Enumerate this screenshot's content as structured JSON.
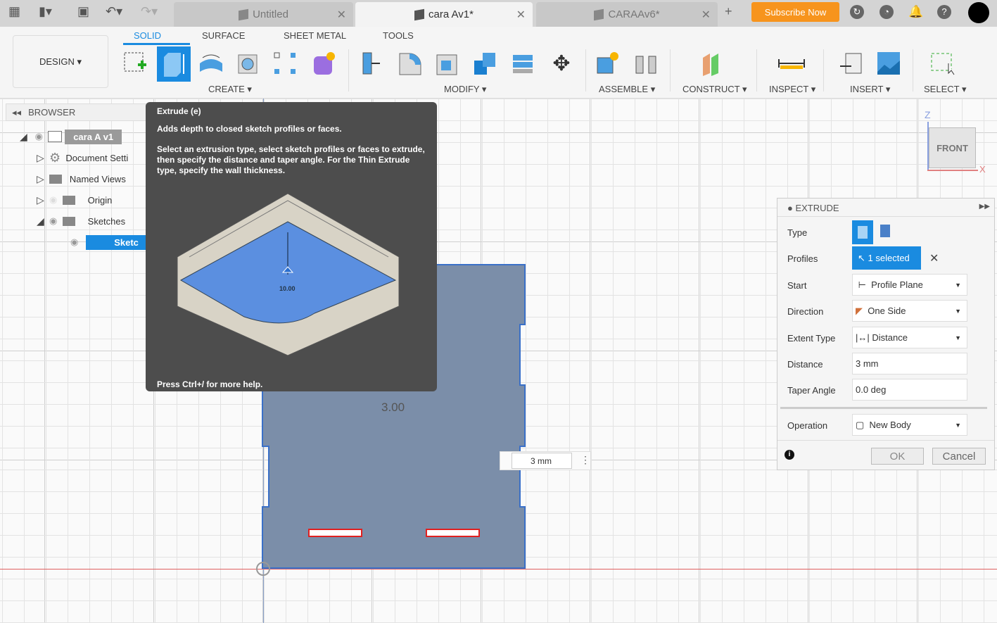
{
  "tabs": [
    {
      "label": "Untitled",
      "active": false
    },
    {
      "label": "cara Av1*",
      "active": true
    },
    {
      "label": "CARAAv6*",
      "active": false
    }
  ],
  "subscribe_label": "Subscribe Now",
  "toolbar": {
    "design_label": "DESIGN ▾",
    "tabs": [
      "SOLID",
      "SURFACE",
      "SHEET METAL",
      "TOOLS"
    ],
    "groups": [
      "CREATE ▾",
      "MODIFY ▾",
      "ASSEMBLE ▾",
      "CONSTRUCT ▾",
      "INSPECT ▾",
      "INSERT ▾",
      "SELECT ▾"
    ]
  },
  "browser": {
    "title": "BROWSER",
    "items": [
      "cara A v1",
      "Document Setti",
      "Named Views",
      "Origin",
      "Sketches",
      "Sketc"
    ]
  },
  "tooltip": {
    "title": "Extrude (e)",
    "summary": "Adds depth to closed sketch profiles or faces.",
    "detail": "Select an extrusion type, select sketch profiles or faces to extrude, then specify the distance and taper angle. For the Thin Extrude type, specify the wall thickness.",
    "illustration_label": "10.00",
    "footer": "Press Ctrl+/ for more help."
  },
  "viewcube": {
    "face": "FRONT",
    "axis_z": "Z",
    "axis_x": "X"
  },
  "canvas": {
    "dimension_label": "3.00",
    "distance_input": "3 mm",
    "sketch_color": "#7b8ea9"
  },
  "extrude": {
    "title": "EXTRUDE",
    "type_label": "Type",
    "profiles_label": "Profiles",
    "profiles_value": "1 selected",
    "start_label": "Start",
    "start_value": "Profile Plane",
    "direction_label": "Direction",
    "direction_value": "One Side",
    "extent_label": "Extent Type",
    "extent_value": "Distance",
    "distance_label": "Distance",
    "distance_value": "3 mm",
    "taper_label": "Taper Angle",
    "taper_value": "0.0 deg",
    "operation_label": "Operation",
    "operation_value": "New Body",
    "ok": "OK",
    "cancel": "Cancel"
  },
  "accent": "#1a8be0"
}
